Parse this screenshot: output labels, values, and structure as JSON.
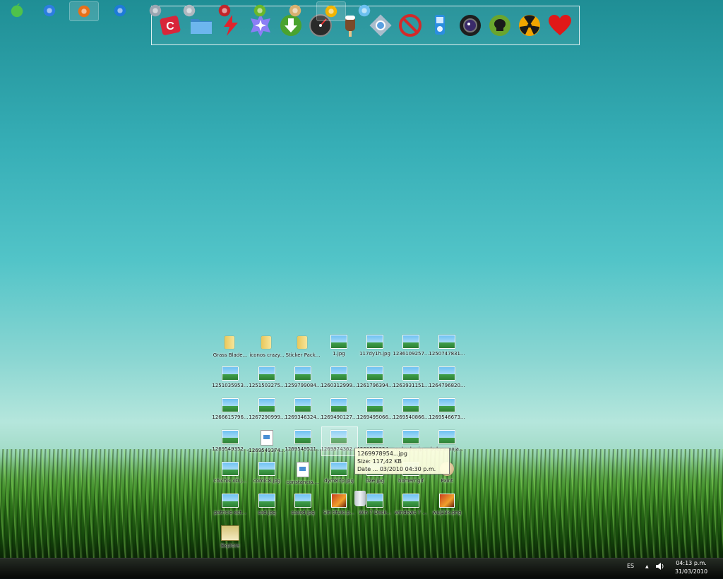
{
  "dock": {
    "items": [
      {
        "name": "red-c-app-icon",
        "color": "#d8263a"
      },
      {
        "name": "folder-icon",
        "color": "#5aa4e0"
      },
      {
        "name": "lightning-icon",
        "color": "#e0242e"
      },
      {
        "name": "star-badge-icon",
        "color": "#7a6cf0"
      },
      {
        "name": "download-arrow-icon",
        "color": "#4aa32e"
      },
      {
        "name": "speedometer-icon",
        "color": "#333333"
      },
      {
        "name": "popsicle-icon",
        "color": "#7a4a2a"
      },
      {
        "name": "crosshair-icon",
        "color": "#8aa0b0"
      },
      {
        "name": "no-entry-icon",
        "color": "#d22a2a"
      },
      {
        "name": "ipod-icon",
        "color": "#2b8ee0"
      },
      {
        "name": "camera-lens-icon",
        "color": "#1e1e1e"
      },
      {
        "name": "skull-icon",
        "color": "#5a9a2a"
      },
      {
        "name": "radiation-icon",
        "color": "#f2a500"
      },
      {
        "name": "heart-icon",
        "color": "#e01818"
      }
    ]
  },
  "desktop": {
    "icons": [
      {
        "label": "Grass Blade...",
        "type": "folder"
      },
      {
        "label": "iconos crazy...",
        "type": "folder"
      },
      {
        "label": "Sticker Pack...",
        "type": "folder"
      },
      {
        "label": "1.jpg",
        "type": "image"
      },
      {
        "label": "117dy1h.jpg",
        "type": "image"
      },
      {
        "label": "1236109257...",
        "type": "image"
      },
      {
        "label": "1250747831...",
        "type": "image"
      },
      {
        "label": "1251035953...",
        "type": "image"
      },
      {
        "label": "1251503275...",
        "type": "image"
      },
      {
        "label": "1259799084...",
        "type": "image"
      },
      {
        "label": "1260312999...",
        "type": "image"
      },
      {
        "label": "1261796394...",
        "type": "image"
      },
      {
        "label": "1263931151...",
        "type": "image"
      },
      {
        "label": "1264796820...",
        "type": "image"
      },
      {
        "label": "1266615796...",
        "type": "image"
      },
      {
        "label": "1267290999...",
        "type": "image"
      },
      {
        "label": "1269346324...",
        "type": "image"
      },
      {
        "label": "1269490127...",
        "type": "image"
      },
      {
        "label": "1269495066...",
        "type": "image"
      },
      {
        "label": "1269540866...",
        "type": "image"
      },
      {
        "label": "1269546673...",
        "type": "image"
      },
      {
        "label": "1269549352...",
        "type": "image"
      },
      {
        "label": "1269549374...",
        "type": "doc"
      },
      {
        "label": "1269549521...",
        "type": "image"
      },
      {
        "label": "1269974362...",
        "type": "image"
      },
      {
        "label": "1269978954...",
        "type": "image"
      },
      {
        "label": "asdasdas.jp...",
        "type": "image"
      },
      {
        "label": "bobesponja...",
        "type": "image"
      },
      {
        "label": "chichis xD.j...",
        "type": "image"
      },
      {
        "label": "comic8.jpg",
        "type": "image"
      },
      {
        "label": "constancia....",
        "type": "doc"
      },
      {
        "label": "dym87p.jpg",
        "type": "image"
      },
      {
        "label": "dae.jpg",
        "type": "image"
      },
      {
        "label": "homerr.gif",
        "type": "image"
      },
      {
        "label": "Paint",
        "type": "paint"
      },
      {
        "label": "patricio est...",
        "type": "image"
      },
      {
        "label": "sad.jpg",
        "type": "image"
      },
      {
        "label": "saasd.jpg",
        "type": "image"
      },
      {
        "label": "Sin título.p...",
        "type": "redpic"
      },
      {
        "label": "Win 7 Desk...",
        "type": "image"
      },
      {
        "label": "windows 7 ...",
        "type": "image"
      },
      {
        "label": "wuj23k.png",
        "type": "redpic"
      },
      {
        "label": "Explore",
        "type": "explore"
      }
    ],
    "recycle_bin": {
      "name": "recycle-bin-icon"
    },
    "tooltip": {
      "line1": "1269978954...jpg",
      "line2": "Size: 117,42 KB",
      "line3": "Date ... 03/2010 04:30 p.m."
    }
  },
  "taskbar": {
    "start_icon": "apple-icon",
    "apps": [
      {
        "name": "safari-icon",
        "active": false
      },
      {
        "name": "firefox-icon",
        "active": true
      },
      {
        "name": "leaf-app-icon",
        "active": false
      },
      {
        "name": "robot-app-icon",
        "active": false
      },
      {
        "name": "guitar-icon",
        "active": false
      },
      {
        "name": "game-app-icon",
        "active": false
      },
      {
        "name": "turtle-icon",
        "active": false
      },
      {
        "name": "paint-palette-icon",
        "active": false
      },
      {
        "name": "walking-man-icon",
        "active": true
      },
      {
        "name": "itunes-icon",
        "active": false
      }
    ],
    "tray": {
      "language": "ES",
      "up_arrow": "▲",
      "volume_icon": "speaker-icon",
      "time": "04:13 p.m.",
      "date": "31/03/2010"
    }
  }
}
